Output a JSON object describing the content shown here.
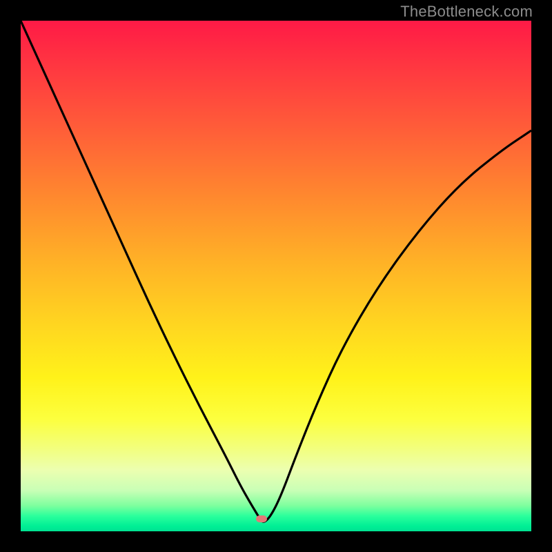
{
  "watermark": "TheBottleneck.com",
  "marker": {
    "x_frac": 0.472,
    "y_frac": 0.976
  },
  "colors": {
    "curve": "#000000",
    "marker": "#e27878",
    "frame": "#000000"
  },
  "chart_data": {
    "type": "line",
    "title": "",
    "xlabel": "",
    "ylabel": "",
    "xlim": [
      0,
      1
    ],
    "ylim": [
      0,
      1
    ],
    "series": [
      {
        "name": "bottleneck-curve",
        "x": [
          0.0,
          0.05,
          0.1,
          0.15,
          0.2,
          0.25,
          0.3,
          0.35,
          0.4,
          0.43,
          0.45,
          0.465,
          0.475,
          0.49,
          0.51,
          0.54,
          0.58,
          0.63,
          0.7,
          0.78,
          0.86,
          0.94,
          1.0
        ],
        "y": [
          1.0,
          0.89,
          0.78,
          0.67,
          0.56,
          0.45,
          0.345,
          0.245,
          0.15,
          0.09,
          0.055,
          0.03,
          0.015,
          0.03,
          0.07,
          0.15,
          0.25,
          0.36,
          0.48,
          0.59,
          0.68,
          0.745,
          0.785
        ]
      }
    ],
    "annotations": [
      {
        "type": "marker",
        "x": 0.472,
        "y": 0.024,
        "label": "optimal-point"
      }
    ],
    "background": "vertical-gradient red→yellow→green (heatmap-like severity scale)"
  }
}
